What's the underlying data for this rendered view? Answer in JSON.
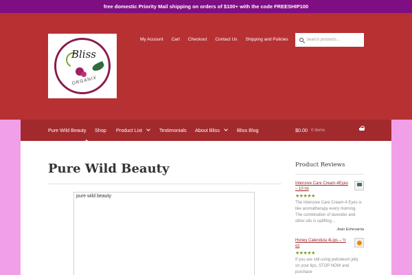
{
  "promo": {
    "text": "free domestic Priority Mail shipping on orders of $100+ with the code FREESHIP100"
  },
  "logo": {
    "word": "Bliss",
    "subtitle": "ORGANIX"
  },
  "secondary_nav": [
    "My Account",
    "Cart",
    "Checkout",
    "Contact Us",
    "Shipping and Policies"
  ],
  "search": {
    "placeholder": "Search products..."
  },
  "primary_nav": {
    "items": [
      {
        "label": "Pure Wild Beauty",
        "dropdown": false,
        "active": true
      },
      {
        "label": "Shop",
        "dropdown": false
      },
      {
        "label": "Product List",
        "dropdown": true
      },
      {
        "label": "Testimonials",
        "dropdown": false
      },
      {
        "label": "About Bliss",
        "dropdown": true
      },
      {
        "label": "Bliss Blog",
        "dropdown": false
      }
    ],
    "cart_total": "$0.00",
    "cart_count": "0 items"
  },
  "page": {
    "title": "Pure Wild Beauty",
    "frame_label": "pure wild beauty"
  },
  "sidebar": {
    "title": "Product Reviews",
    "reviews": [
      {
        "product": "Intensive Care Cream-4Eyes – 10 ml",
        "stars": "★★★★★",
        "rating": 5,
        "text": "The Intensive Care Cream-4 Eyes is like aromatherapy every morning. The combination of lavender and other oils is uplifting…",
        "author": "Jean Echevarria"
      },
      {
        "product": "Honey Calendula 4Lips – ½ oz",
        "stars": "★★★★★",
        "rating": 5,
        "text": "If you are still using petroleum jelly on your lips, STOP NOW and purchase",
        "author": ""
      }
    ]
  },
  "colors": {
    "promo_bar": "#7f0e82",
    "header": "#b73133",
    "nav_bar": "#a22a2d",
    "page_background": "#f1a0e8",
    "link": "#9b2426",
    "stars": "#7a9a1e"
  }
}
